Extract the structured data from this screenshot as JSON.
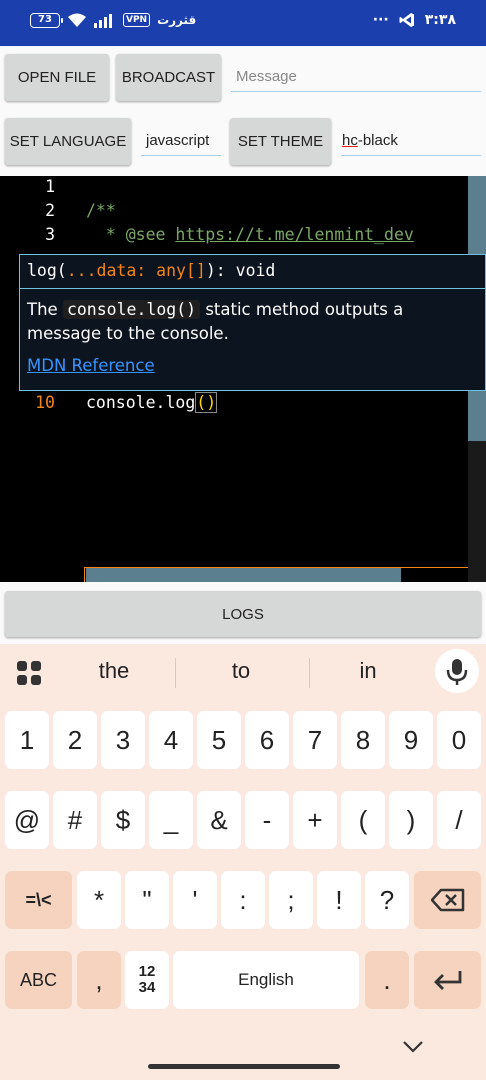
{
  "status_bar": {
    "battery": "73",
    "vpn": "VPN",
    "carrier": "قثررت",
    "more": "···",
    "time": "۳:۳۸"
  },
  "controls": {
    "open_file": "OPEN FILE",
    "broadcast": "BROADCAST",
    "message_placeholder": "Message",
    "set_language": "SET LANGUAGE",
    "language_value": "javascript",
    "set_theme": "SET THEME",
    "theme_value_a": "hc",
    "theme_value_b": "-black"
  },
  "editor": {
    "lines": [
      {
        "num": "1",
        "text": ""
      },
      {
        "num": "2",
        "text": "/**"
      },
      {
        "num": "3",
        "prefix": "  * @see ",
        "link": "https://t.me/lenmint_dev"
      },
      {
        "num": "10",
        "call": "console.log",
        "parens": "()"
      }
    ],
    "hover": {
      "sig_name": "log(",
      "sig_param": "...data: any[]",
      "sig_end": "): void",
      "doc_pre": "The ",
      "doc_code": "console.log()",
      "doc_post": " static method outputs a message to the console.",
      "link": "MDN Reference"
    },
    "colors": {
      "background": "#000000",
      "accent": "#f38518",
      "border": "#6fc3df",
      "link": "#3794ff"
    }
  },
  "logs": {
    "label": "LOGS"
  },
  "keyboard": {
    "suggestions": [
      "the",
      "to",
      "in"
    ],
    "row1": [
      "1",
      "2",
      "3",
      "4",
      "5",
      "6",
      "7",
      "8",
      "9",
      "0"
    ],
    "row2": [
      "@",
      "#",
      "$",
      "_",
      "&",
      "-",
      "+",
      "(",
      ")",
      "/"
    ],
    "row3": [
      "=\\<",
      "*",
      "\"",
      "'",
      ":",
      ";",
      "!",
      "?"
    ],
    "abc": "ABC",
    "comma": ",",
    "numpad_top": "12",
    "numpad_bottom": "34",
    "space": "English",
    "period": "."
  }
}
